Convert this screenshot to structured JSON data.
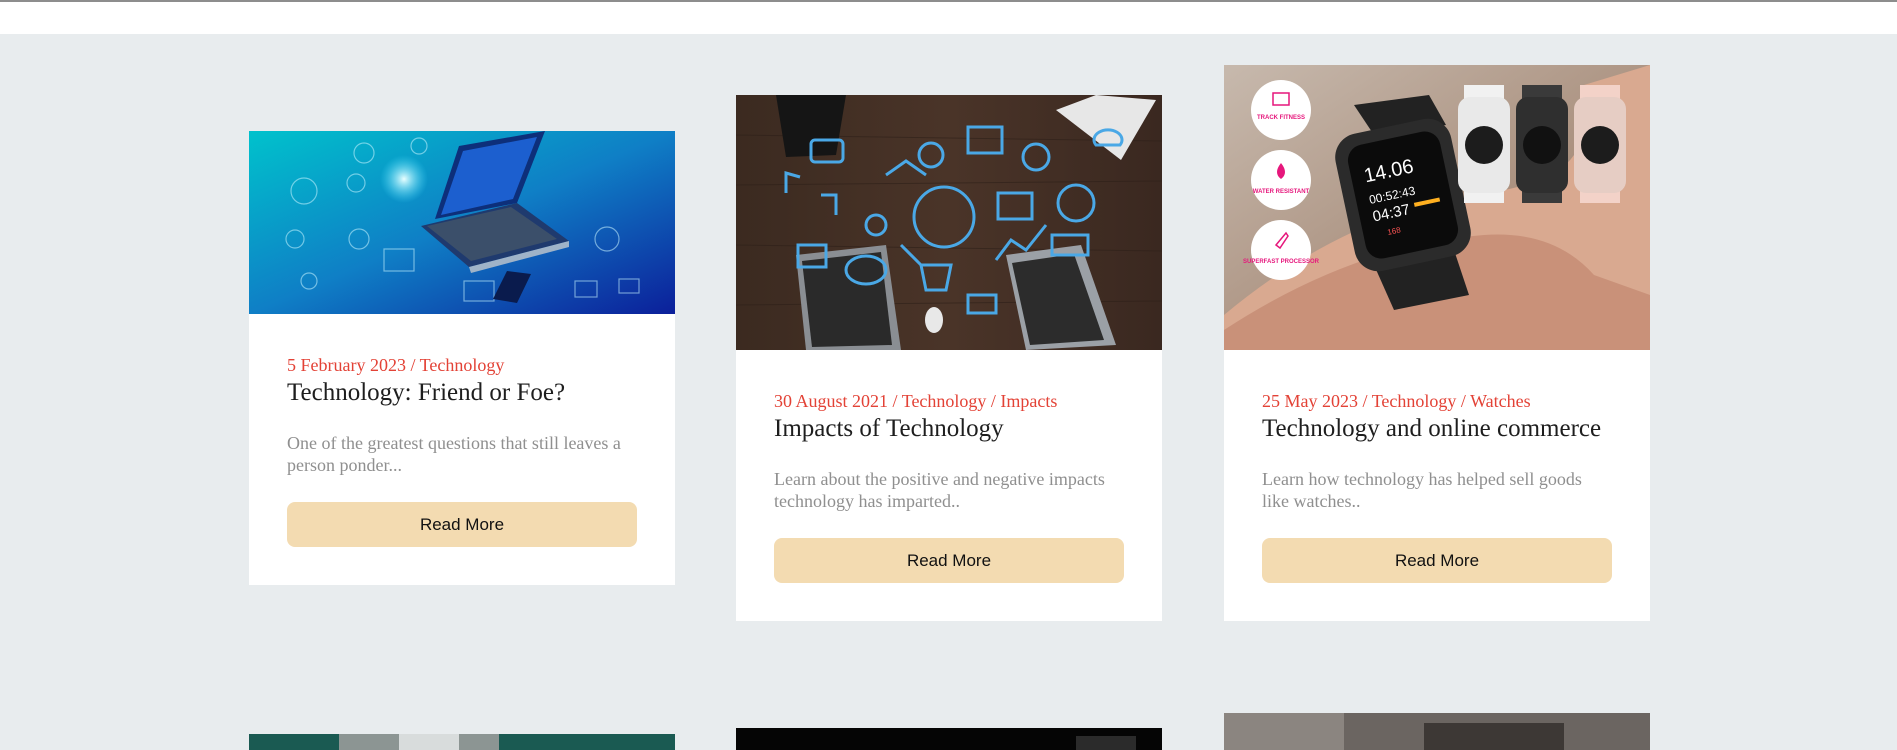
{
  "posts": [
    {
      "date": "5 February 2023",
      "categories": "Technology",
      "title": "Technology: Friend or Foe?",
      "excerpt": "One of the greatest questions that still leaves a person ponder...",
      "button": "Read More"
    },
    {
      "date": "30 August 2021",
      "categories": "Technology / Impacts",
      "title": "Impacts of Technology",
      "excerpt": "Learn about the positive and negative impacts technology has imparted..",
      "button": "Read More"
    },
    {
      "date": "25 May 2023",
      "categories": "Technology / Watches",
      "title": "Technology and online commerce",
      "excerpt": "Learn how technology has helped sell goods like watches..",
      "button": "Read More"
    }
  ],
  "image_badges": {
    "track": "TRACK FITNESS",
    "water": "WATER RESISTANT",
    "processor": "SUPERFAST PROCESSOR"
  },
  "watch_screen": {
    "date": "14.06",
    "time1": "00:52:43",
    "time2": "04:37",
    "bpm": "168"
  },
  "colors": {
    "background": "#e8ecee",
    "accent": "#e34236",
    "button": "#f3dbb1"
  }
}
